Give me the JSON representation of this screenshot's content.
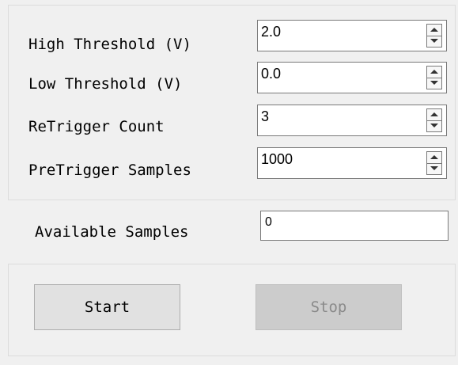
{
  "params": {
    "high_threshold": {
      "label": "High Threshold (V)",
      "value": "2.0"
    },
    "low_threshold": {
      "label": "Low Threshold (V)",
      "value": "0.0"
    },
    "retrigger_count": {
      "label": "ReTrigger Count",
      "value": "3"
    },
    "pretrigger_samples": {
      "label": "PreTrigger Samples",
      "value": "1000"
    }
  },
  "available": {
    "label": "Available Samples",
    "value": "0"
  },
  "actions": {
    "start_label": "Start",
    "stop_label": "Stop",
    "stop_enabled": false
  }
}
